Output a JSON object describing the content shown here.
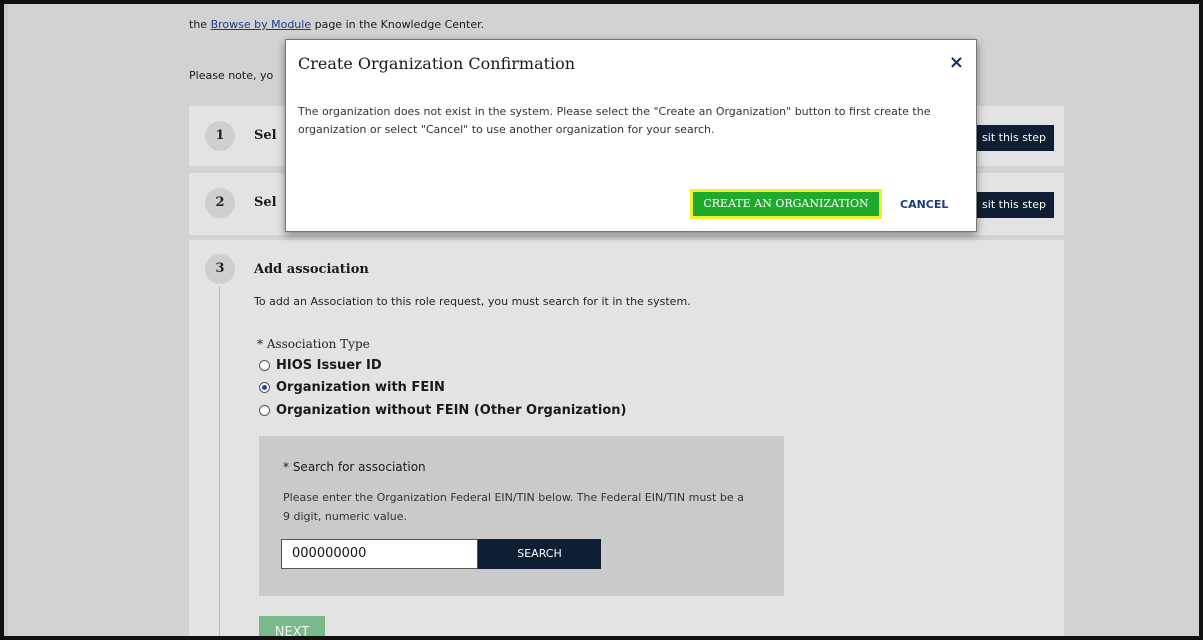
{
  "intro": {
    "line1_prefix": "the ",
    "line1_link": "Browse by Module",
    "line1_suffix": " page in the Knowledge Center.",
    "line2": "Please note, yo"
  },
  "steps": [
    {
      "number": "1",
      "title": "Sel",
      "revisit_label": "sit this step"
    },
    {
      "number": "2",
      "title": "Sel",
      "revisit_label": "sit this step"
    },
    {
      "number": "3",
      "title": "Add association"
    }
  ],
  "association": {
    "description": "To add an Association to this role request, you must search for it in the system.",
    "type_label": "* Association Type",
    "options": [
      {
        "label": "HIOS Issuer ID",
        "checked": false
      },
      {
        "label": "Organization with FEIN",
        "checked": true
      },
      {
        "label": "Organization without FEIN (Other Organization)",
        "checked": false
      }
    ]
  },
  "search": {
    "label": "* Search for association",
    "help": "Please enter the Organization Federal EIN/TIN below. The Federal EIN/TIN must be a 9 digit, numeric value.",
    "value": "000000000",
    "button": "SEARCH"
  },
  "next_button": "NEXT",
  "modal": {
    "title": "Create Organization Confirmation",
    "close_symbol": "×",
    "body": "The organization does not exist in the system. Please select the \"Create an Organization\" button to first create the organization or select \"Cancel\" to use another organization for your search.",
    "create_button": "CREATE AN ORGANIZATION",
    "cancel_button": "CANCEL"
  },
  "colors": {
    "primary_dark": "#0f1e33",
    "create_green": "#1faa2e",
    "highlight_yellow": "#f0f02a",
    "link_blue": "#1a3a8a"
  }
}
